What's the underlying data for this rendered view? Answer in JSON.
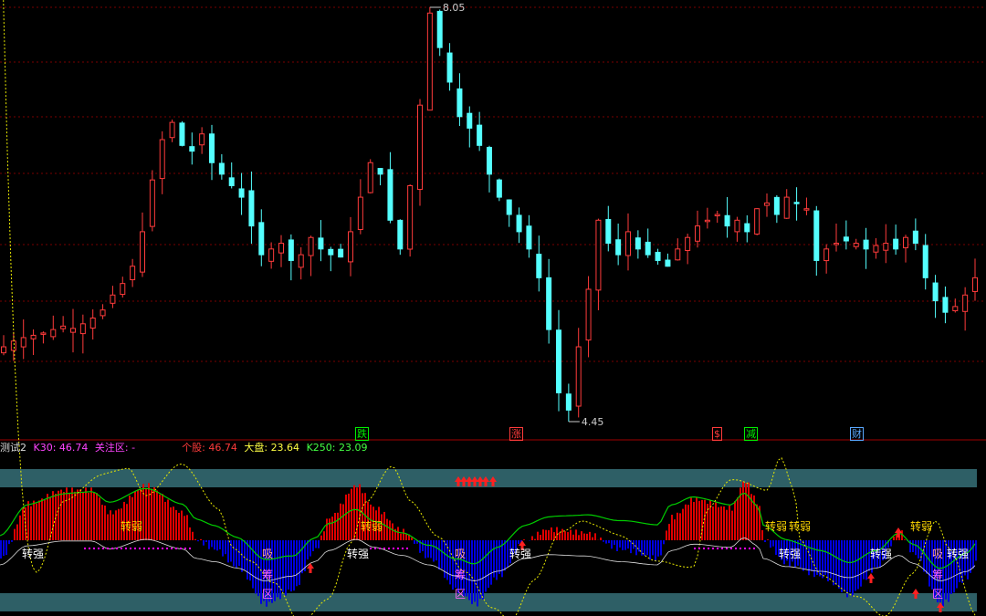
{
  "indicator": {
    "name": "测试2",
    "k30_label": "K30:",
    "k30_value": "46.74",
    "focus_label": "关注区:",
    "focus_value": "-",
    "stock_label": "个股:",
    "stock_value": "46.74",
    "market_label": "大盘:",
    "market_value": "23.64",
    "k250_label": "K250:",
    "k250_value": "23.09"
  },
  "colors": {
    "up": "#ff3b3b",
    "down": "#54ffff",
    "grid": "#7a0000",
    "band": "#2e5f66",
    "red_bar": "#e00000",
    "blue_bar": "#0000e0",
    "green_line": "#00cc00",
    "yellow_line": "#e8e800",
    "magenta": "#ff00ff",
    "white_line": "#dddddd"
  },
  "events": [
    {
      "text": "跌",
      "color": "#00ee00"
    },
    {
      "text": "涨",
      "color": "#ff3b3b"
    },
    {
      "text": "$",
      "color": "#ff3b3b"
    },
    {
      "text": "减",
      "color": "#00ee00"
    },
    {
      "text": "财",
      "color": "#5aa8ff"
    }
  ],
  "labels": {
    "strong": "转强",
    "weak": "转弱",
    "xi": "吸",
    "chou": "筹",
    "qu": "区"
  },
  "chart_data": {
    "type": "candlestick",
    "price_high_label": "8.05",
    "price_low_label": "4.45",
    "close": [
      5.1,
      5.15,
      5.18,
      5.2,
      5.22,
      5.25,
      5.28,
      5.26,
      5.3,
      5.35,
      5.42,
      5.55,
      5.65,
      5.8,
      6.1,
      6.55,
      6.9,
      7.05,
      6.85,
      6.8,
      6.95,
      6.7,
      6.6,
      6.5,
      6.4,
      6.15,
      5.9,
      5.95,
      6.0,
      5.85,
      5.9,
      6.05,
      5.95,
      5.9,
      5.88,
      6.1,
      6.4,
      6.7,
      6.6,
      6.2,
      5.95,
      6.5,
      7.2,
      8.0,
      7.7,
      7.4,
      7.1,
      7.0,
      6.85,
      6.6,
      6.4,
      6.25,
      6.1,
      5.95,
      5.7,
      5.25,
      4.7,
      4.55,
      5.1,
      5.6,
      6.2,
      6.0,
      5.9,
      6.1,
      5.95,
      5.9,
      5.85,
      5.8,
      5.95,
      6.05,
      6.15,
      6.2,
      6.25,
      6.15,
      6.2,
      6.1,
      6.3,
      6.35,
      6.25,
      6.4,
      6.35,
      6.3,
      5.85,
      5.95,
      6.0,
      6.02,
      6.0,
      5.95,
      5.98,
      6.0,
      5.95,
      6.05,
      6.0,
      5.7,
      5.5,
      5.4,
      5.45,
      5.55,
      5.7
    ]
  }
}
